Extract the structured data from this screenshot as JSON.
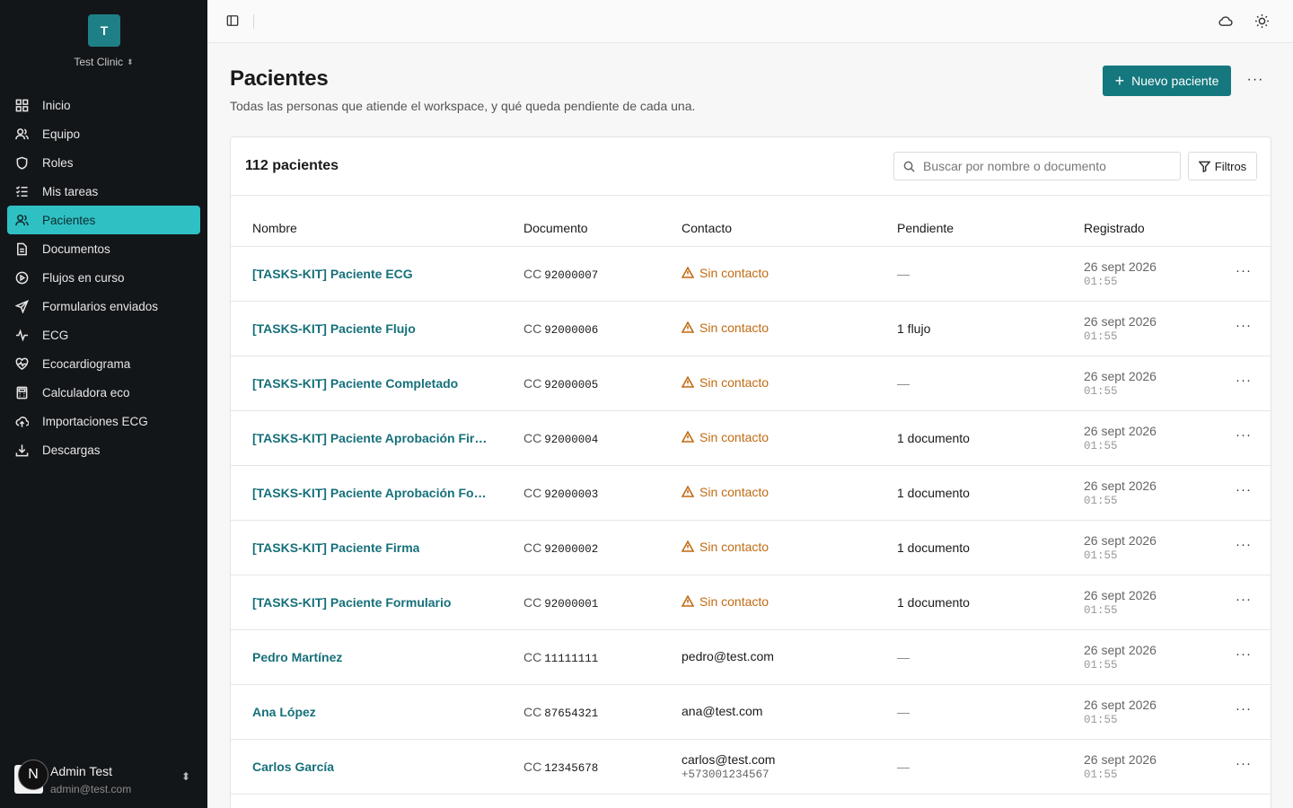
{
  "workspace": {
    "initial": "T",
    "name": "Test Clinic"
  },
  "nav": [
    {
      "label": "Inicio",
      "icon": "grid-icon",
      "active": false
    },
    {
      "label": "Equipo",
      "icon": "users-icon",
      "active": false
    },
    {
      "label": "Roles",
      "icon": "shield-icon",
      "active": false
    },
    {
      "label": "Mis tareas",
      "icon": "checklist-icon",
      "active": false
    },
    {
      "label": "Pacientes",
      "icon": "patients-icon",
      "active": true
    },
    {
      "label": "Documentos",
      "icon": "document-icon",
      "active": false
    },
    {
      "label": "Flujos en curso",
      "icon": "play-circle-icon",
      "active": false
    },
    {
      "label": "Formularios enviados",
      "icon": "send-icon",
      "active": false
    },
    {
      "label": "ECG",
      "icon": "pulse-icon",
      "active": false
    },
    {
      "label": "Ecocardiograma",
      "icon": "heart-pulse-icon",
      "active": false
    },
    {
      "label": "Calculadora eco",
      "icon": "calculator-icon",
      "active": false
    },
    {
      "label": "Importaciones ECG",
      "icon": "upload-cloud-icon",
      "active": false
    },
    {
      "label": "Descargas",
      "icon": "download-icon",
      "active": false
    }
  ],
  "user": {
    "initial": "N",
    "name": "Admin Test",
    "email": "admin@test.com"
  },
  "header": {
    "title": "Pacientes",
    "subtitle": "Todas las personas que atiende el workspace, y qué queda pendiente de cada una.",
    "new_button": "Nuevo paciente"
  },
  "table": {
    "count_label": "112 pacientes",
    "search_placeholder": "Buscar por nombre o documento",
    "filter_label": "Filtros",
    "columns": [
      "Nombre",
      "Documento",
      "Contacto",
      "Pendiente",
      "Registrado"
    ],
    "rows": [
      {
        "name": "[TASKS-KIT] Paciente ECG",
        "doc_type": "CC",
        "doc_number": "92000007",
        "contact": "Sin contacto",
        "contact_warning": true,
        "phone": "",
        "pending": "—",
        "date": "26 sept 2026",
        "time": "01:55"
      },
      {
        "name": "[TASKS-KIT] Paciente Flujo",
        "doc_type": "CC",
        "doc_number": "92000006",
        "contact": "Sin contacto",
        "contact_warning": true,
        "phone": "",
        "pending": "1 flujo",
        "date": "26 sept 2026",
        "time": "01:55"
      },
      {
        "name": "[TASKS-KIT] Paciente Completado",
        "doc_type": "CC",
        "doc_number": "92000005",
        "contact": "Sin contacto",
        "contact_warning": true,
        "phone": "",
        "pending": "—",
        "date": "26 sept 2026",
        "time": "01:55"
      },
      {
        "name": "[TASKS-KIT] Paciente Aprobación Firm...",
        "doc_type": "CC",
        "doc_number": "92000004",
        "contact": "Sin contacto",
        "contact_warning": true,
        "phone": "",
        "pending": "1 documento",
        "date": "26 sept 2026",
        "time": "01:55"
      },
      {
        "name": "[TASKS-KIT] Paciente Aprobación Form...",
        "doc_type": "CC",
        "doc_number": "92000003",
        "contact": "Sin contacto",
        "contact_warning": true,
        "phone": "",
        "pending": "1 documento",
        "date": "26 sept 2026",
        "time": "01:55"
      },
      {
        "name": "[TASKS-KIT] Paciente Firma",
        "doc_type": "CC",
        "doc_number": "92000002",
        "contact": "Sin contacto",
        "contact_warning": true,
        "phone": "",
        "pending": "1 documento",
        "date": "26 sept 2026",
        "time": "01:55"
      },
      {
        "name": "[TASKS-KIT] Paciente Formulario",
        "doc_type": "CC",
        "doc_number": "92000001",
        "contact": "Sin contacto",
        "contact_warning": true,
        "phone": "",
        "pending": "1 documento",
        "date": "26 sept 2026",
        "time": "01:55"
      },
      {
        "name": "Pedro Martínez",
        "doc_type": "CC",
        "doc_number": "11111111",
        "contact": "pedro@test.com",
        "contact_warning": false,
        "phone": "",
        "pending": "—",
        "date": "26 sept 2026",
        "time": "01:55"
      },
      {
        "name": "Ana López",
        "doc_type": "CC",
        "doc_number": "87654321",
        "contact": "ana@test.com",
        "contact_warning": false,
        "phone": "",
        "pending": "—",
        "date": "26 sept 2026",
        "time": "01:55"
      },
      {
        "name": "Carlos García",
        "doc_type": "CC",
        "doc_number": "12345678",
        "contact": "carlos@test.com",
        "contact_warning": false,
        "phone": "+573001234567",
        "pending": "—",
        "date": "26 sept 2026",
        "time": "01:55"
      }
    ]
  },
  "colors": {
    "accent": "#14787e",
    "active_nav": "#2fc0c3",
    "sidebar_bg": "#131619",
    "warning": "#c26a12",
    "link": "#16707a"
  }
}
